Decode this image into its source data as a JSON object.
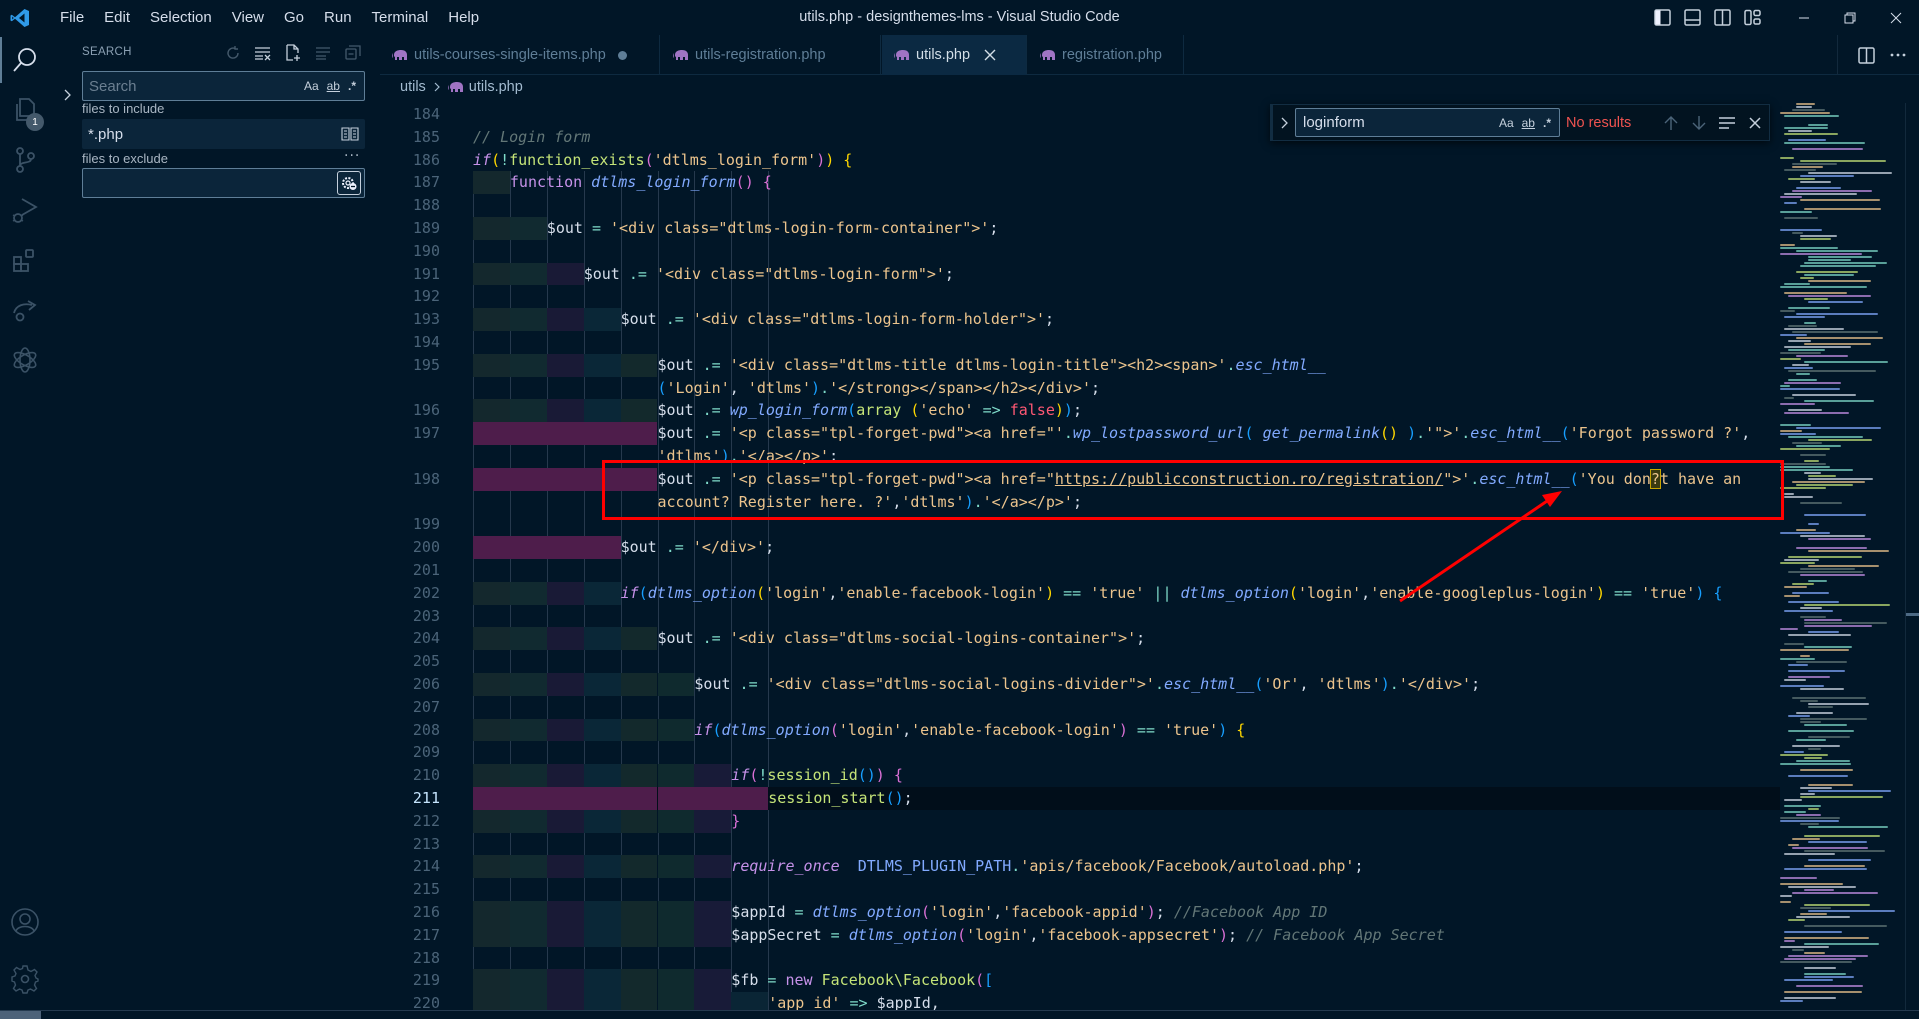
{
  "window": {
    "title": "utils.php - designthemes-lms - Visual Studio Code",
    "menu": [
      "File",
      "Edit",
      "Selection",
      "View",
      "Go",
      "Run",
      "Terminal",
      "Help"
    ]
  },
  "activity_bar": {
    "items": [
      {
        "name": "search",
        "icon": "search-icon",
        "active": true
      },
      {
        "name": "explorer",
        "icon": "files-icon",
        "badge": "1"
      },
      {
        "name": "source-control",
        "icon": "source-control-icon"
      },
      {
        "name": "run-debug",
        "icon": "debug-icon"
      },
      {
        "name": "extensions",
        "icon": "extensions-icon"
      },
      {
        "name": "live-share",
        "icon": "share-icon"
      },
      {
        "name": "chatgpt",
        "icon": "openai-icon"
      }
    ],
    "bottom": [
      {
        "name": "accounts",
        "icon": "account-icon"
      },
      {
        "name": "manage",
        "icon": "gear-icon"
      }
    ]
  },
  "search_panel": {
    "header": "SEARCH",
    "search_placeholder": "Search",
    "search_value": "",
    "options": [
      "Aa",
      "ab",
      ".*"
    ],
    "files_to_include_label": "files to include",
    "files_to_include_value": "*.php",
    "files_to_exclude_label": "files to exclude",
    "files_to_exclude_value": "",
    "more": "···"
  },
  "tabs": [
    {
      "label": "utils-courses-single-items.php",
      "dirty": true
    },
    {
      "label": "utils-registration.php"
    },
    {
      "label": "utils.php",
      "active": true
    },
    {
      "label": "registration.php"
    }
  ],
  "breadcrumb": [
    "utils",
    "utils.php"
  ],
  "find_widget": {
    "value": "loginform",
    "options": [
      "Aa",
      "ab",
      ".*"
    ],
    "status": "No results"
  },
  "colors": {
    "background": "#011627",
    "annotation": "#ff0000",
    "find_no_results": "#ef5350"
  },
  "code": {
    "current_line": 211,
    "lines": [
      {
        "n": "184"
      },
      {
        "n": "185"
      },
      {
        "n": "186"
      },
      {
        "n": "187"
      },
      {
        "n": "188"
      },
      {
        "n": "189"
      },
      {
        "n": "190"
      },
      {
        "n": "191"
      },
      {
        "n": "192"
      },
      {
        "n": "193"
      },
      {
        "n": "194"
      },
      {
        "n": "195"
      },
      {
        "n": "196"
      },
      {
        "n": "197"
      },
      {
        "n": "198"
      },
      {
        "n": "199"
      },
      {
        "n": "200"
      },
      {
        "n": "201"
      },
      {
        "n": "202"
      },
      {
        "n": "203"
      },
      {
        "n": "204"
      },
      {
        "n": "205"
      },
      {
        "n": "206"
      },
      {
        "n": "207"
      },
      {
        "n": "208"
      },
      {
        "n": "209"
      },
      {
        "n": "210"
      },
      {
        "n": "211"
      },
      {
        "n": "212"
      },
      {
        "n": "213"
      },
      {
        "n": "214"
      },
      {
        "n": "215"
      },
      {
        "n": "216"
      },
      {
        "n": "217"
      },
      {
        "n": "218"
      },
      {
        "n": "219"
      },
      {
        "n": "220"
      }
    ],
    "rows": [
      {
        "ln": "184",
        "indent": 0,
        "tokens": []
      },
      {
        "ln": "185",
        "indent": 0,
        "tokens": [
          [
            "cm",
            "// Login form"
          ]
        ]
      },
      {
        "ln": "186",
        "indent": 0,
        "tokens": [
          [
            "kw",
            "if"
          ],
          [
            "p1",
            "("
          ],
          [
            "op",
            "!"
          ],
          [
            "fn2",
            "function_exists"
          ],
          [
            "p2",
            "("
          ],
          [
            "str",
            "'dtlms_login_form'"
          ],
          [
            "p2",
            ")"
          ],
          [
            "p1",
            ")"
          ],
          [
            "var",
            " "
          ],
          [
            "p1",
            "{"
          ]
        ]
      },
      {
        "ln": "187",
        "indent": 1,
        "tokens": [
          [
            "kw2",
            "function"
          ],
          [
            "var",
            " "
          ],
          [
            "fn",
            "dtlms_login_form"
          ],
          [
            "p2",
            "()"
          ],
          [
            "var",
            " "
          ],
          [
            "p2",
            "{"
          ]
        ]
      },
      {
        "ln": "188",
        "indent": 0,
        "tokens": []
      },
      {
        "ln": "189",
        "indent": 2,
        "tokens": [
          [
            "var",
            "$out"
          ],
          [
            "op",
            " = "
          ],
          [
            "str",
            "'<div class=\"dtlms-login-form-container\">'"
          ],
          [
            "var",
            ";"
          ]
        ]
      },
      {
        "ln": "190",
        "indent": 0,
        "tokens": []
      },
      {
        "ln": "191",
        "indent": 3,
        "tokens": [
          [
            "var",
            "$out"
          ],
          [
            "op",
            " .= "
          ],
          [
            "str",
            "'<div class=\"dtlms-login-form\">'"
          ],
          [
            "var",
            ";"
          ]
        ]
      },
      {
        "ln": "192",
        "indent": 0,
        "tokens": []
      },
      {
        "ln": "193",
        "indent": 4,
        "tokens": [
          [
            "var",
            "$out"
          ],
          [
            "op",
            " .= "
          ],
          [
            "str",
            "'<div class=\"dtlms-login-form-holder\">'"
          ],
          [
            "var",
            ";"
          ]
        ]
      },
      {
        "ln": "194",
        "indent": 0,
        "tokens": []
      },
      {
        "ln": "195",
        "indent": 5,
        "tokens": [
          [
            "var",
            "$out"
          ],
          [
            "op",
            " .= "
          ],
          [
            "str",
            "'<div class=\"dtlms-title dtlms-login-title\"><h2><span>'"
          ],
          [
            "op",
            "."
          ],
          [
            "fn",
            "esc_html__"
          ]
        ]
      },
      {
        "ln": "",
        "indent": 5,
        "wrap": true,
        "tokens": [
          [
            "p3",
            "("
          ],
          [
            "str",
            "'Login'"
          ],
          [
            "var",
            ", "
          ],
          [
            "str",
            "'dtlms'"
          ],
          [
            "p3",
            ")"
          ],
          [
            "op",
            "."
          ],
          [
            "str",
            "'</strong></span></h2></div>'"
          ],
          [
            "var",
            ";"
          ]
        ]
      },
      {
        "ln": "196",
        "indent": 5,
        "tokens": [
          [
            "var",
            "$out"
          ],
          [
            "op",
            " .= "
          ],
          [
            "fn",
            "wp_login_form"
          ],
          [
            "p3",
            "("
          ],
          [
            "fn2",
            "array"
          ],
          [
            "var",
            " "
          ],
          [
            "p1",
            "("
          ],
          [
            "str",
            "'echo'"
          ],
          [
            "op",
            " => "
          ],
          [
            "bool",
            "false"
          ],
          [
            "p1",
            ")"
          ],
          [
            "p3",
            ")"
          ],
          [
            "var",
            ";"
          ]
        ]
      },
      {
        "ln": "197",
        "indent": 5,
        "tokens": [
          [
            "var",
            "$out"
          ],
          [
            "op",
            " .= "
          ],
          [
            "str",
            "'<p class=\"tpl-forget-pwd\"><a href=\"'"
          ],
          [
            "op",
            "."
          ],
          [
            "fn",
            "wp_lostpassword_url"
          ],
          [
            "p3",
            "("
          ],
          [
            "var",
            " "
          ],
          [
            "fn",
            "get_permalink"
          ],
          [
            "p1",
            "()"
          ],
          [
            "var",
            " "
          ],
          [
            "p3",
            ")"
          ],
          [
            "op",
            "."
          ],
          [
            "str",
            "'\">'"
          ],
          [
            "op",
            "."
          ],
          [
            "fn",
            "esc_html__"
          ],
          [
            "p3",
            "("
          ],
          [
            "str",
            "'Forgot password ?'"
          ],
          [
            "var",
            ","
          ]
        ]
      },
      {
        "ln": "",
        "indent": 5,
        "wrap": true,
        "tokens": [
          [
            "str",
            "'dtlms'"
          ],
          [
            "p3",
            ")"
          ],
          [
            "op",
            "."
          ],
          [
            "str",
            "'</a></p>'"
          ],
          [
            "var",
            ";"
          ]
        ]
      },
      {
        "ln": "198",
        "indent": 5,
        "tokens": [
          [
            "var",
            "$out"
          ],
          [
            "op",
            " .= "
          ],
          [
            "str",
            "'<p class=\"tpl-forget-pwd\"><a href=\""
          ],
          [
            "url",
            "https://publicconstruction.ro/registration/"
          ],
          [
            "str",
            "\">'"
          ],
          [
            "op",
            "."
          ],
          [
            "fn",
            "esc_html__"
          ],
          [
            "p3",
            "("
          ],
          [
            "str",
            "'You don"
          ],
          [
            "match",
            "?"
          ],
          [
            "str",
            "t have an"
          ]
        ]
      },
      {
        "ln": "",
        "indent": 5,
        "wrap": true,
        "tokens": [
          [
            "str",
            "account? Register here. ?'"
          ],
          [
            "var",
            ","
          ],
          [
            "str",
            "'dtlms'"
          ],
          [
            "p3",
            ")"
          ],
          [
            "op",
            "."
          ],
          [
            "str",
            "'</a></p>'"
          ],
          [
            "var",
            ";"
          ]
        ]
      },
      {
        "ln": "199",
        "indent": 0,
        "tokens": []
      },
      {
        "ln": "200",
        "indent": 4,
        "tokens": [
          [
            "var",
            "$out"
          ],
          [
            "op",
            " .= "
          ],
          [
            "str",
            "'</div>'"
          ],
          [
            "var",
            ";"
          ]
        ]
      },
      {
        "ln": "201",
        "indent": 0,
        "tokens": []
      },
      {
        "ln": "202",
        "indent": 4,
        "tokens": [
          [
            "kw",
            "if"
          ],
          [
            "p3",
            "("
          ],
          [
            "fn",
            "dtlms_option"
          ],
          [
            "p1",
            "("
          ],
          [
            "str",
            "'login'"
          ],
          [
            "var",
            ","
          ],
          [
            "str",
            "'enable-facebook-login'"
          ],
          [
            "p1",
            ")"
          ],
          [
            "op",
            " == "
          ],
          [
            "str",
            "'true'"
          ],
          [
            "op",
            " || "
          ],
          [
            "fn",
            "dtlms_option"
          ],
          [
            "p1",
            "("
          ],
          [
            "str",
            "'login'"
          ],
          [
            "var",
            ","
          ],
          [
            "str",
            "'enable-googleplus-login'"
          ],
          [
            "p1",
            ")"
          ],
          [
            "op",
            " == "
          ],
          [
            "str",
            "'true'"
          ],
          [
            "p3",
            ")"
          ],
          [
            "var",
            " "
          ],
          [
            "p3",
            "{"
          ]
        ]
      },
      {
        "ln": "203",
        "indent": 0,
        "tokens": []
      },
      {
        "ln": "204",
        "indent": 5,
        "tokens": [
          [
            "var",
            "$out"
          ],
          [
            "op",
            " .= "
          ],
          [
            "str",
            "'<div class=\"dtlms-social-logins-container\">'"
          ],
          [
            "var",
            ";"
          ]
        ]
      },
      {
        "ln": "205",
        "indent": 0,
        "tokens": []
      },
      {
        "ln": "206",
        "indent": 6,
        "tokens": [
          [
            "var",
            "$out"
          ],
          [
            "op",
            " .= "
          ],
          [
            "str",
            "'<div class=\"dtlms-social-logins-divider\">'"
          ],
          [
            "op",
            "."
          ],
          [
            "fn",
            "esc_html__"
          ],
          [
            "p3",
            "("
          ],
          [
            "str",
            "'Or'"
          ],
          [
            "var",
            ", "
          ],
          [
            "str",
            "'dtlms'"
          ],
          [
            "p3",
            ")"
          ],
          [
            "op",
            "."
          ],
          [
            "str",
            "'</div>'"
          ],
          [
            "var",
            ";"
          ]
        ]
      },
      {
        "ln": "207",
        "indent": 0,
        "tokens": []
      },
      {
        "ln": "208",
        "indent": 6,
        "tokens": [
          [
            "kw",
            "if"
          ],
          [
            "p3",
            "("
          ],
          [
            "fn",
            "dtlms_option"
          ],
          [
            "p2",
            "("
          ],
          [
            "str",
            "'login'"
          ],
          [
            "var",
            ","
          ],
          [
            "str",
            "'enable-facebook-login'"
          ],
          [
            "p2",
            ")"
          ],
          [
            "op",
            " == "
          ],
          [
            "str",
            "'true'"
          ],
          [
            "p3",
            ")"
          ],
          [
            "var",
            " "
          ],
          [
            "p1",
            "{"
          ]
        ]
      },
      {
        "ln": "209",
        "indent": 0,
        "tokens": []
      },
      {
        "ln": "210",
        "indent": 7,
        "tokens": [
          [
            "kw",
            "if"
          ],
          [
            "p2",
            "("
          ],
          [
            "op",
            "!"
          ],
          [
            "fn2",
            "session_id"
          ],
          [
            "p3",
            "()"
          ],
          [
            "p2",
            ")"
          ],
          [
            "var",
            " "
          ],
          [
            "p2",
            "{"
          ]
        ]
      },
      {
        "ln": "211",
        "indent": 8,
        "tokens": [
          [
            "fn2",
            "session_start"
          ],
          [
            "p3",
            "()"
          ],
          [
            "var",
            ";"
          ]
        ]
      },
      {
        "ln": "212",
        "indent": 7,
        "tokens": [
          [
            "p2",
            "}"
          ]
        ]
      },
      {
        "ln": "213",
        "indent": 0,
        "tokens": []
      },
      {
        "ln": "214",
        "indent": 7,
        "tokens": [
          [
            "kw",
            "require_once"
          ],
          [
            "var",
            "  "
          ],
          [
            "const",
            "DTLMS_PLUGIN_PATH"
          ],
          [
            "op",
            "."
          ],
          [
            "str",
            "'apis/facebook/Facebook/autoload.php'"
          ],
          [
            "var",
            ";"
          ]
        ]
      },
      {
        "ln": "215",
        "indent": 0,
        "tokens": []
      },
      {
        "ln": "216",
        "indent": 7,
        "tokens": [
          [
            "var",
            "$appId"
          ],
          [
            "op",
            " = "
          ],
          [
            "fn",
            "dtlms_option"
          ],
          [
            "p2",
            "("
          ],
          [
            "str",
            "'login'"
          ],
          [
            "var",
            ","
          ],
          [
            "str",
            "'facebook-appid'"
          ],
          [
            "p2",
            ")"
          ],
          [
            "var",
            "; "
          ],
          [
            "cm",
            "//Facebook App ID"
          ]
        ]
      },
      {
        "ln": "217",
        "indent": 7,
        "tokens": [
          [
            "var",
            "$appSecret"
          ],
          [
            "op",
            " = "
          ],
          [
            "fn",
            "dtlms_option"
          ],
          [
            "p2",
            "("
          ],
          [
            "str",
            "'login'"
          ],
          [
            "var",
            ","
          ],
          [
            "str",
            "'facebook-appsecret'"
          ],
          [
            "p2",
            ")"
          ],
          [
            "var",
            "; "
          ],
          [
            "cm",
            "// Facebook App Secret"
          ]
        ]
      },
      {
        "ln": "218",
        "indent": 0,
        "tokens": []
      },
      {
        "ln": "219",
        "indent": 7,
        "tokens": [
          [
            "var",
            "$fb"
          ],
          [
            "op",
            " = "
          ],
          [
            "kw2",
            "new"
          ],
          [
            "var",
            " "
          ],
          [
            "fn2",
            "Facebook\\Facebook"
          ],
          [
            "p2",
            "("
          ],
          [
            "p3",
            "["
          ]
        ]
      },
      {
        "ln": "220",
        "indent": 8,
        "tokens": [
          [
            "str",
            "'app_id'"
          ],
          [
            "op",
            " => "
          ],
          [
            "var",
            "$appId"
          ],
          [
            "var",
            ","
          ]
        ]
      }
    ]
  }
}
